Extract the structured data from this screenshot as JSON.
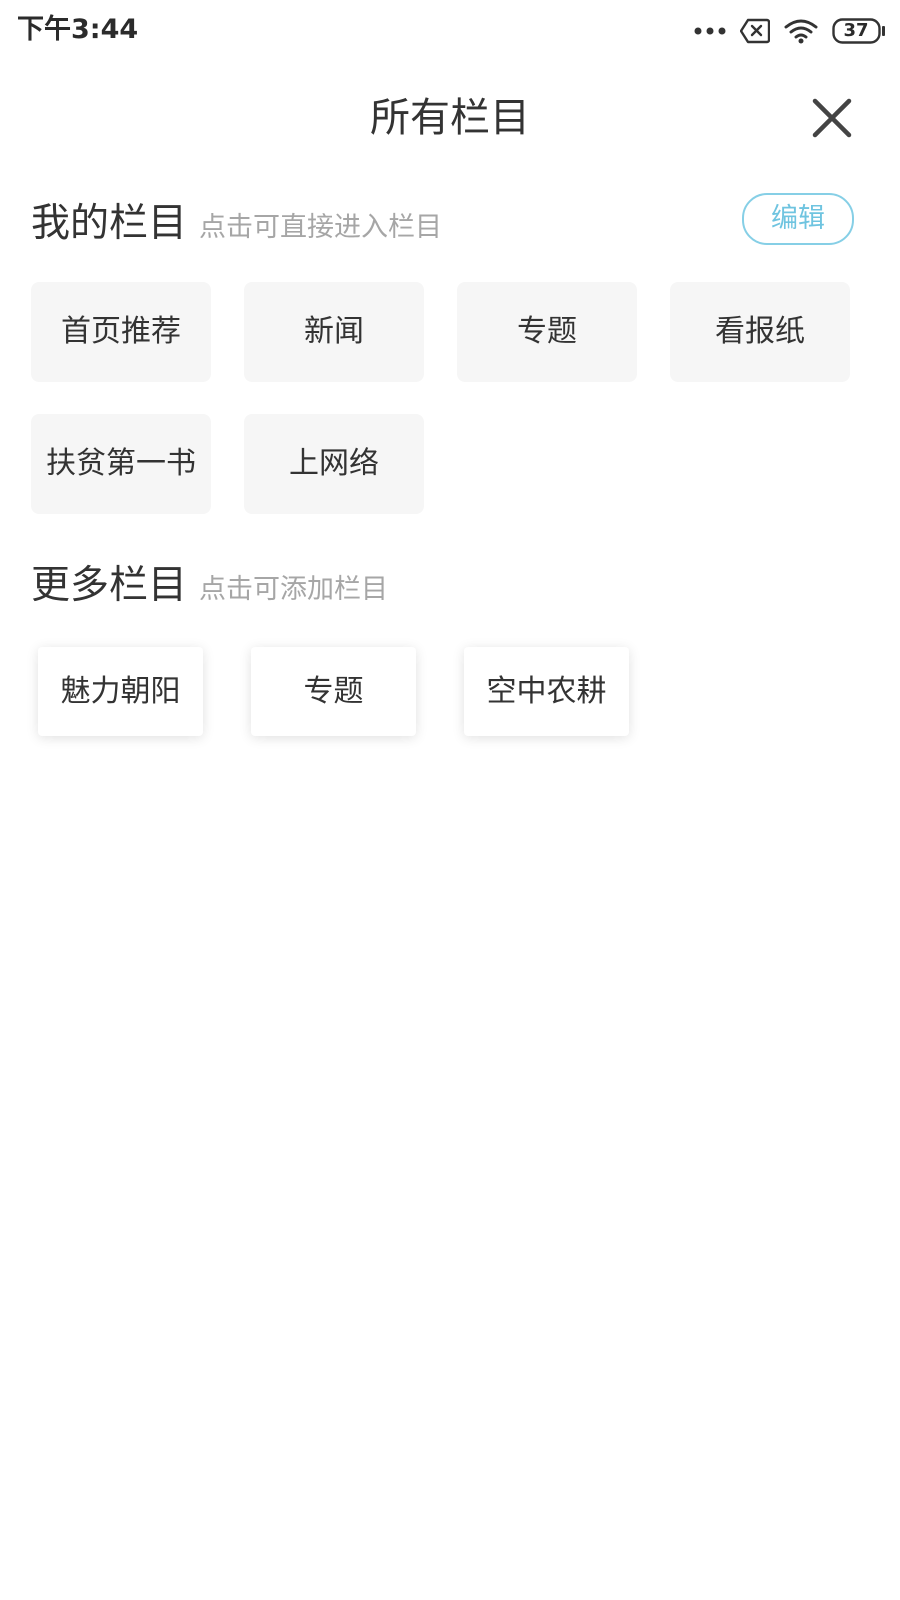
{
  "status_bar": {
    "time": "下午3:44",
    "battery_level": "37",
    "icons": [
      "more-dots-icon",
      "sim-error-icon",
      "wifi-icon",
      "battery-icon"
    ]
  },
  "header": {
    "title": "所有栏目",
    "close_icon": "close-icon"
  },
  "my_channels": {
    "title": "我的栏目",
    "hint": "点击可直接进入栏目",
    "edit_label": "编辑",
    "items": [
      {
        "label": "首页推荐"
      },
      {
        "label": "新闻"
      },
      {
        "label": "专题"
      },
      {
        "label": "看报纸"
      },
      {
        "label": "扶贫第一书"
      },
      {
        "label": "上网络"
      }
    ]
  },
  "more_channels": {
    "title": "更多栏目",
    "hint": "点击可添加栏目",
    "items": [
      {
        "label": "魅力朝阳"
      },
      {
        "label": "专题"
      },
      {
        "label": "空中农耕"
      }
    ]
  },
  "colors": {
    "accent": "#6fc4e0",
    "tile_bg": "#f6f6f6",
    "text": "#333333",
    "hint": "#a6a6a6"
  }
}
